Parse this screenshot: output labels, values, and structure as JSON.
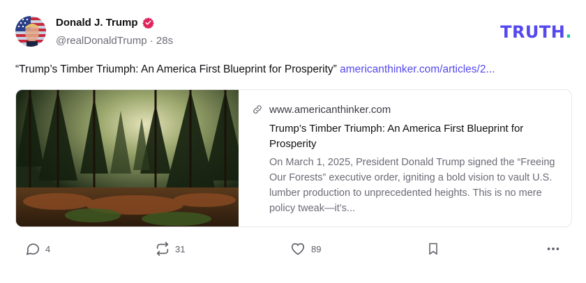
{
  "author": {
    "name": "Donald J. Trump",
    "handle": "@realDonaldTrump",
    "separator": " · ",
    "time": "28s"
  },
  "brand": {
    "logo_text": "TRUTH",
    "logo_dot": "."
  },
  "post": {
    "text": "“Trump’s Timber Triumph: An America First Blueprint for Prosperity”",
    "link": "americanthinker.com/articles/2..."
  },
  "card": {
    "domain": "www.americanthinker.com",
    "title": "Trump’s Timber Triumph: An America First Blueprint for Prosperity",
    "description": "On March 1, 2025, President Donald Trump signed the “Freeing Our Forests” executive order, igniting a bold vision to vault U.S. lumber production to unprecedented heights. This is no mere policy tweak—it’s..."
  },
  "actions": {
    "replies": "4",
    "retruths": "31",
    "likes": "89"
  },
  "colors": {
    "accent": "#5448ee",
    "brand_dot": "#18c7a4",
    "verified": "#e0245e",
    "muted": "#6b6b76"
  },
  "icons": [
    "verified-badge-icon",
    "link-icon",
    "reply-icon",
    "retruth-icon",
    "heart-icon",
    "bookmark-icon",
    "more-icon"
  ]
}
